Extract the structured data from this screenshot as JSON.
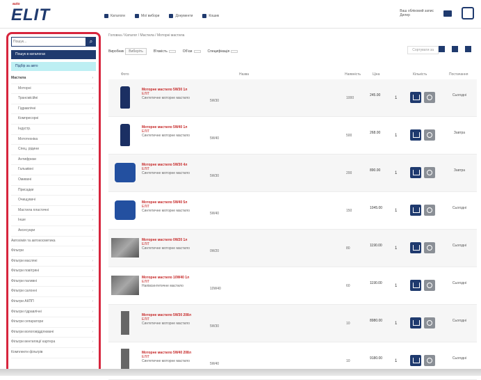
{
  "header": {
    "logo_small": "auto",
    "logo": "ELIT",
    "nav": [
      "Каталоги",
      "Мої вибори",
      "Документи",
      "Кошик"
    ],
    "account": [
      "Ваш обліковий запис",
      "Дилер"
    ],
    "colors": {
      "brand": "#1f3a6e",
      "accent": "#c62828",
      "highlight": "#d7253d"
    }
  },
  "sidebar": {
    "search_placeholder": "Пошук...",
    "btn_primary": "Пошук в каталогах",
    "btn_secondary": "Підбір за авто",
    "categories": [
      {
        "label": "Мастила",
        "level": "head"
      },
      {
        "label": "Моторні",
        "level": "sub"
      },
      {
        "label": "Трансмісійні",
        "level": "sub"
      },
      {
        "label": "Гідравлічні",
        "level": "sub"
      },
      {
        "label": "Компресорні",
        "level": "sub"
      },
      {
        "label": "Індустр.",
        "level": "sub"
      },
      {
        "label": "Мототехніка",
        "level": "sub"
      },
      {
        "label": "Спец. рідини",
        "level": "sub"
      },
      {
        "label": "Антифризи",
        "level": "sub"
      },
      {
        "label": "Гальмівні",
        "level": "sub"
      },
      {
        "label": "Омивачі",
        "level": "sub"
      },
      {
        "label": "Присадки",
        "level": "sub"
      },
      {
        "label": "Очищувачі",
        "level": "sub"
      },
      {
        "label": "Мастила пластичні",
        "level": "sub"
      },
      {
        "label": "Інше",
        "level": "sub"
      },
      {
        "label": "Аксесуари",
        "level": "sub"
      },
      {
        "label": "Автохімія та автокосметика",
        "level": "top"
      },
      {
        "label": "Фільтри",
        "level": "top"
      },
      {
        "label": "Фільтри масляні",
        "level": "top"
      },
      {
        "label": "Фільтри повітряні",
        "level": "top"
      },
      {
        "label": "Фільтри паливні",
        "level": "top"
      },
      {
        "label": "Фільтри салонні",
        "level": "top"
      },
      {
        "label": "Фільтри АКПП",
        "level": "top"
      },
      {
        "label": "Фільтри гідравлічні",
        "level": "top"
      },
      {
        "label": "Фільтри сепаратори",
        "level": "top"
      },
      {
        "label": "Фільтри вологовідділювачі",
        "level": "top"
      },
      {
        "label": "Фільтри вентиляції картера",
        "level": "top"
      },
      {
        "label": "Комплекти фільтрів",
        "level": "top"
      }
    ]
  },
  "breadcrumb": "Головна / Каталог / Мастила / Моторні мастила",
  "filters": {
    "items": [
      {
        "label": "Виробник",
        "value": "Виберіть"
      },
      {
        "label": "В'язкість",
        "value": ""
      },
      {
        "label": "Об'єм",
        "value": ""
      },
      {
        "label": "Специфікація",
        "value": ""
      }
    ],
    "sort": "Сортувати за"
  },
  "columns": [
    "Фото",
    "Назва",
    "Наявність",
    "Ціна",
    "Кількість",
    "Постачання"
  ],
  "products": [
    {
      "title": "Моторне мастило 5W30 1л",
      "sku": "ЕЛІТ",
      "desc": "Синтетичне моторне мастило",
      "spec": "5W30",
      "stock": "1000",
      "price": "245.00",
      "qty": "1",
      "delivery": "Сьогодні",
      "img": "bottle"
    },
    {
      "title": "Моторне мастило 5W40 1л",
      "sku": "ЕЛІТ",
      "desc": "Синтетичне моторне мастило",
      "spec": "5W40",
      "stock": "500",
      "price": "268.00",
      "qty": "1",
      "delivery": "Завтра",
      "img": "bottle"
    },
    {
      "title": "Моторне мастило 5W30 4л",
      "sku": "ЕЛІТ",
      "desc": "Синтетичне моторне мастило",
      "spec": "5W30",
      "stock": "200",
      "price": "890.00",
      "qty": "1",
      "delivery": "Завтра",
      "img": "canister"
    },
    {
      "title": "Моторне мастило 5W40 5л",
      "sku": "ЕЛІТ",
      "desc": "Синтетичне моторне мастило",
      "spec": "5W40",
      "stock": "150",
      "price": "1045.00",
      "qty": "1",
      "delivery": "Сьогодні",
      "img": "canister"
    },
    {
      "title": "Моторне мастило 0W20 1л",
      "sku": "ЕЛІТ",
      "desc": "Синтетичне моторне мастило",
      "spec": "0W20",
      "stock": "80",
      "price": "1190.00",
      "qty": "1",
      "delivery": "Сьогодні",
      "img": "photo"
    },
    {
      "title": "Моторне мастило 10W40 1л",
      "sku": "ЕЛІТ",
      "desc": "Напівсинтетичне мастило",
      "spec": "10W40",
      "stock": "60",
      "price": "1190.00",
      "qty": "1",
      "delivery": "Сьогодні",
      "img": "photo"
    },
    {
      "title": "Моторне мастило 5W30 208л",
      "sku": "ЕЛІТ",
      "desc": "Синтетичне моторне мастило",
      "spec": "5W30",
      "stock": "10",
      "price": "8980.00",
      "qty": "1",
      "delivery": "Сьогодні",
      "img": "filter"
    },
    {
      "title": "Моторне мастило 5W40 208л",
      "sku": "ЕЛІТ",
      "desc": "Синтетичне моторне мастило",
      "spec": "5W40",
      "stock": "10",
      "price": "9180.00",
      "qty": "1",
      "delivery": "Сьогодні",
      "img": "filter"
    }
  ]
}
